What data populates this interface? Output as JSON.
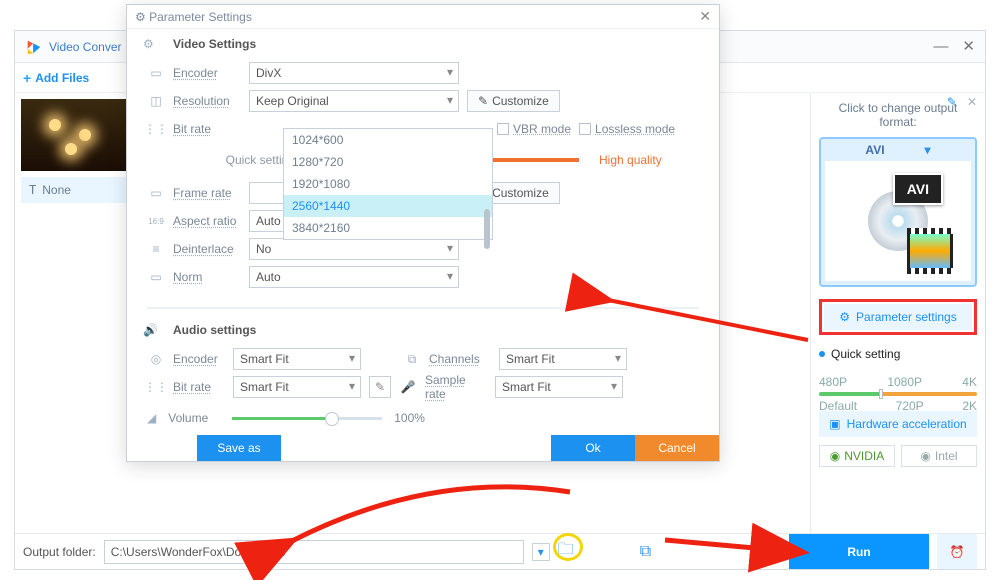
{
  "main": {
    "title": "Video Conver",
    "add_files": "Add Files",
    "none": "None",
    "output_folder_label": "Output folder:",
    "output_folder": "C:\\Users\\WonderFox\\Downloads",
    "run": "Run"
  },
  "right": {
    "title": "Click to change output format:",
    "format": "AVI",
    "format_badge": "AVI",
    "param_settings": "Parameter settings",
    "quick_setting": "Quick setting",
    "ticks_top": [
      "480P",
      "1080P",
      "4K"
    ],
    "ticks_bot": [
      "Default",
      "720P",
      "2K"
    ],
    "hardware": "Hardware acceleration",
    "gpu1": "NVIDIA",
    "gpu2": "Intel"
  },
  "dlg": {
    "title": "Parameter Settings",
    "video_head": "Video Settings",
    "audio_head": "Audio settings",
    "encoder": "Encoder",
    "encoder_val": "DivX",
    "resolution": "Resolution",
    "resolution_val": "Keep Original",
    "bitrate": "Bit rate",
    "bitrate_val": "",
    "framerate": "Frame rate",
    "framerate_val": "",
    "aspect": "Aspect ratio",
    "aspect_val": "Auto",
    "deint": "Deinterlace",
    "deint_val": "No",
    "norm": "Norm",
    "norm_val": "Auto",
    "customize": "Customize",
    "quick": "Quick setting",
    "vbr": "VBR mode",
    "lossless": "Lossless mode",
    "high_quality": "High quality",
    "a_encoder": "Encoder",
    "a_encoder_val": "Smart Fit",
    "a_bitrate": "Bit rate",
    "a_bitrate_val": "Smart Fit",
    "channels": "Channels",
    "channels_val": "Smart Fit",
    "sample": "Sample rate",
    "sample_val": "Smart Fit",
    "volume": "Volume",
    "volume_pct": "100%",
    "save_as": "Save as",
    "ok": "Ok",
    "cancel": "Cancel",
    "reso_opts": [
      "1024*600",
      "1280*720",
      "1920*1080",
      "2560*1440",
      "3840*2160"
    ],
    "reso_sel_index": 3
  }
}
